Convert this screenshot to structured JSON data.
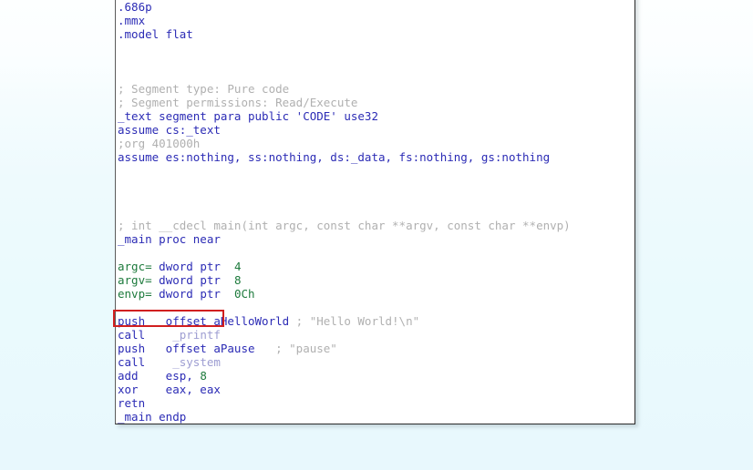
{
  "document": {
    "type": "disassembly-listing",
    "panel_background": "#ffffff",
    "page_background_top": "#fdffff",
    "page_background_bottom": "#e8f8fd"
  },
  "colors": {
    "code": "#2b2bb5",
    "comment": "#b0b0b0",
    "identifier": "#1d7a3c",
    "number": "#1d7a3c",
    "external_symbol": "#9e9ed2",
    "annotation": "#d11f1f"
  },
  "annotation": {
    "name": "call-printf-highlight",
    "shape": "rectangle",
    "color": "#d11f1f",
    "target_line": "call    _printf"
  },
  "listing": {
    "lines": [
      {
        "id": "l01",
        "kind": "code",
        "text": ".686p"
      },
      {
        "id": "l02",
        "kind": "code",
        "text": ".mmx"
      },
      {
        "id": "l03",
        "kind": "code",
        "text": ".model flat"
      },
      {
        "id": "l04",
        "kind": "blank",
        "text": ""
      },
      {
        "id": "l05",
        "kind": "blank",
        "text": ""
      },
      {
        "id": "l06",
        "kind": "blank",
        "text": ""
      },
      {
        "id": "l07",
        "kind": "comment",
        "text": "; Segment type: Pure code"
      },
      {
        "id": "l08",
        "kind": "comment",
        "text": "; Segment permissions: Read/Execute"
      },
      {
        "id": "l09",
        "kind": "code",
        "text": "_text segment para public 'CODE' use32"
      },
      {
        "id": "l10",
        "kind": "code",
        "text": "assume cs:_text"
      },
      {
        "id": "l11",
        "kind": "comment",
        "text": ";org 401000h"
      },
      {
        "id": "l12",
        "kind": "code",
        "text": "assume es:nothing, ss:nothing, ds:_data, fs:nothing, gs:nothing"
      },
      {
        "id": "l13",
        "kind": "blank",
        "text": ""
      },
      {
        "id": "l14",
        "kind": "blank",
        "text": ""
      },
      {
        "id": "l15",
        "kind": "blank",
        "text": ""
      },
      {
        "id": "l16",
        "kind": "blank",
        "text": ""
      },
      {
        "id": "l17",
        "kind": "comment",
        "text": "; int __cdecl main(int argc, const char **argv, const char **envp)"
      },
      {
        "id": "l18",
        "kind": "code",
        "text": "_main proc near"
      },
      {
        "id": "l19",
        "kind": "blank",
        "text": ""
      },
      {
        "id": "l20",
        "kind": "vardecl",
        "name": "argc=",
        "keyword": " dword ptr ",
        "value": " 4"
      },
      {
        "id": "l21",
        "kind": "vardecl",
        "name": "argv=",
        "keyword": " dword ptr ",
        "value": " 8"
      },
      {
        "id": "l22",
        "kind": "vardecl",
        "name": "envp=",
        "keyword": " dword ptr ",
        "value": " 0Ch"
      },
      {
        "id": "l23",
        "kind": "blank",
        "text": ""
      },
      {
        "id": "l24",
        "kind": "instr",
        "mnemonic": "push",
        "operands": "   offset aHelloWorld ",
        "comment": "; \"Hello World!\\n\""
      },
      {
        "id": "l25",
        "kind": "instr-ext",
        "mnemonic": "call",
        "operands": "    _printf",
        "comment": ""
      },
      {
        "id": "l26",
        "kind": "instr",
        "mnemonic": "push",
        "operands": "   offset aPause   ",
        "comment": "; \"pause\""
      },
      {
        "id": "l27",
        "kind": "instr-ext",
        "mnemonic": "call",
        "operands": "    _system",
        "comment": ""
      },
      {
        "id": "l28",
        "kind": "instr-num",
        "mnemonic": "add",
        "operands": "    esp, ",
        "number": "8"
      },
      {
        "id": "l29",
        "kind": "instr",
        "mnemonic": "xor",
        "operands": "    eax, eax",
        "comment": ""
      },
      {
        "id": "l30",
        "kind": "code",
        "text": "retn"
      },
      {
        "id": "l31",
        "kind": "code",
        "text": "_main endp"
      }
    ]
  }
}
